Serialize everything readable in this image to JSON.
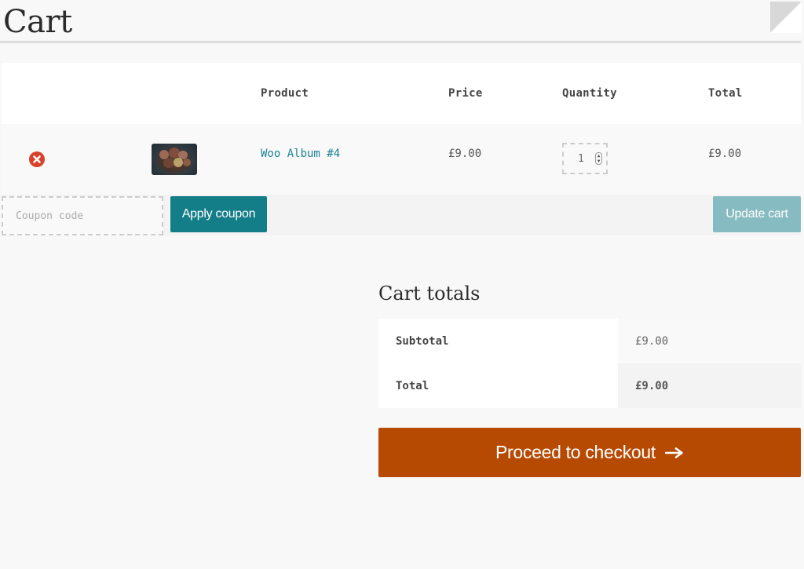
{
  "page": {
    "title": "Cart"
  },
  "cart_table": {
    "headers": {
      "product": "Product",
      "price": "Price",
      "quantity": "Quantity",
      "total": "Total"
    },
    "items": [
      {
        "remove_icon": "remove-circle-icon",
        "thumbnail": "album-cover",
        "name": "Woo Album #4",
        "price": "£9.00",
        "quantity": "1",
        "total": "£9.00"
      }
    ]
  },
  "actions": {
    "coupon_placeholder": "Coupon code",
    "apply_coupon_label": "Apply coupon",
    "update_cart_label": "Update cart"
  },
  "cart_totals": {
    "heading": "Cart totals",
    "subtotal_label": "Subtotal",
    "subtotal_value": "£9.00",
    "total_label": "Total",
    "total_value": "£9.00"
  },
  "checkout": {
    "label": "Proceed to checkout",
    "icon": "arrow-right-icon"
  },
  "colors": {
    "accent_teal": "#137d88",
    "disabled_teal": "#86bbc1",
    "checkout_orange": "#b64a02",
    "remove_red": "#d9412b",
    "link_teal": "#1b8391"
  }
}
